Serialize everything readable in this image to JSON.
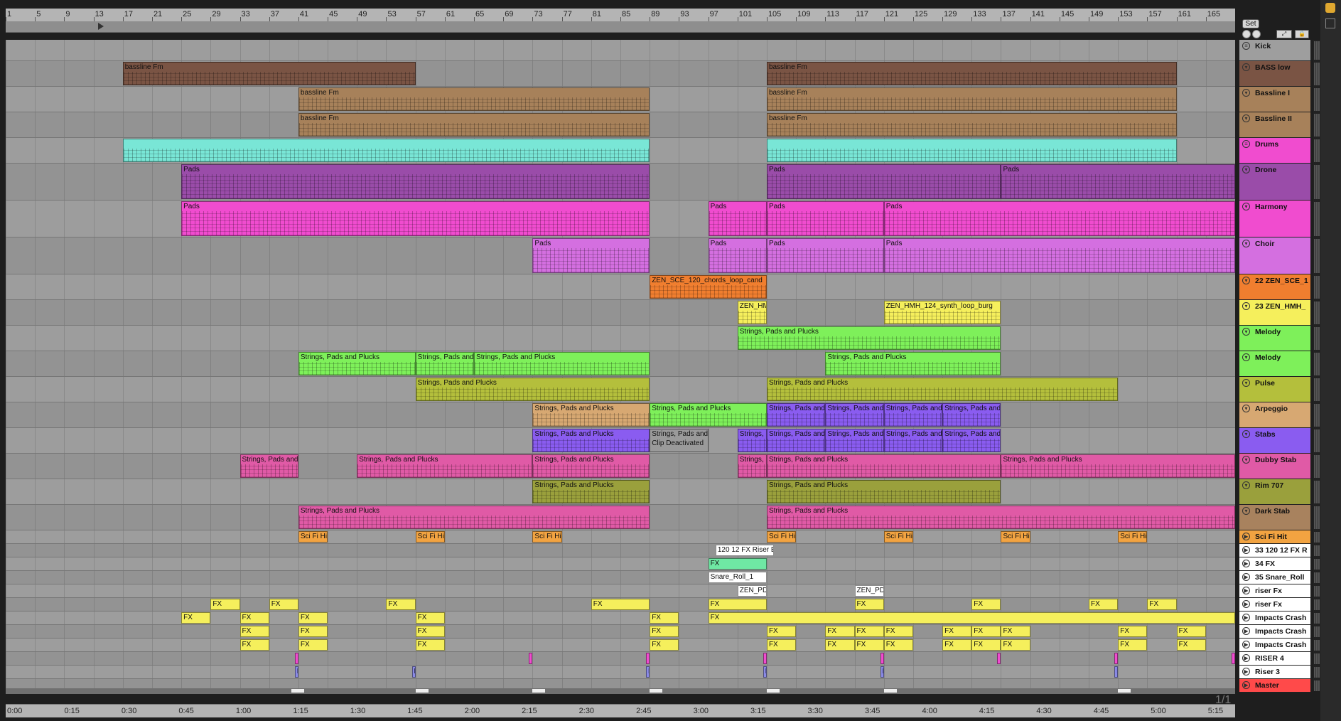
{
  "ruler": {
    "bars": [
      "1",
      "5",
      "9",
      "13",
      "17",
      "21",
      "25",
      "29",
      "33",
      "37",
      "41",
      "45",
      "49",
      "53",
      "57",
      "61",
      "65",
      "69",
      "73",
      "77",
      "81",
      "85",
      "89",
      "93",
      "97",
      "101",
      "105",
      "109",
      "113",
      "117",
      "121",
      "125",
      "129",
      "133",
      "137",
      "141",
      "145",
      "149",
      "153",
      "157",
      "161",
      "165"
    ]
  },
  "timeline": {
    "labels": [
      "0:00",
      "0:15",
      "0:30",
      "0:45",
      "1:00",
      "1:15",
      "1:30",
      "1:45",
      "2:00",
      "2:15",
      "2:30",
      "2:45",
      "3:00",
      "3:15",
      "3:30",
      "3:45",
      "4:00",
      "4:15",
      "4:30",
      "4:45",
      "5:00",
      "5:15"
    ]
  },
  "controls": {
    "set_label": "Set",
    "zoom_label": "1/1"
  },
  "tracks": [
    {
      "name": "Kick",
      "color": "#9e9e9e",
      "icon": "menu"
    },
    {
      "name": "BASS low",
      "color": "#7a5444",
      "icon": "chevron-down"
    },
    {
      "name": "Bassline I",
      "color": "#a7815a",
      "icon": "chevron-down"
    },
    {
      "name": "Bassline II",
      "color": "#a7815a",
      "icon": "chevron-down"
    },
    {
      "name": "Drums",
      "color": "#f04ccf",
      "icon": "menu"
    },
    {
      "name": "Drone",
      "color": "#9a4ca9",
      "icon": "chevron-down"
    },
    {
      "name": "Harmony",
      "color": "#f04ccf",
      "icon": "chevron-down"
    },
    {
      "name": "Choir",
      "color": "#d46fe0",
      "icon": "chevron-down"
    },
    {
      "name": "22 ZEN_SCE_1",
      "color": "#f07e2f",
      "icon": "chevron-down"
    },
    {
      "name": "23 ZEN_HMH_",
      "color": "#f5ef5c",
      "icon": "chevron-down"
    },
    {
      "name": "Melody",
      "color": "#7ef05a",
      "icon": "chevron-down"
    },
    {
      "name": "Melody",
      "color": "#7ef05a",
      "icon": "chevron-down"
    },
    {
      "name": "Pulse",
      "color": "#b4bf3c",
      "icon": "chevron-down"
    },
    {
      "name": "Arpeggio",
      "color": "#d7a872",
      "icon": "chevron-down"
    },
    {
      "name": "Stabs",
      "color": "#8a5cf0",
      "icon": "chevron-down"
    },
    {
      "name": "Dubby Stab",
      "color": "#e05aa6",
      "icon": "chevron-down"
    },
    {
      "name": "Rim 707",
      "color": "#9aa03c",
      "icon": "chevron-down"
    },
    {
      "name": "Dark Stab",
      "color": "#a8825e",
      "icon": "chevron-down"
    },
    {
      "name": "Sci Fi Hit",
      "color": "#f2a341",
      "icon": "play"
    },
    {
      "name": "33 120 12 FX R",
      "color": "#ffffff",
      "icon": "play"
    },
    {
      "name": "34 FX",
      "color": "#ffffff",
      "icon": "play"
    },
    {
      "name": "35 Snare_Roll",
      "color": "#ffffff",
      "icon": "play"
    },
    {
      "name": "riser Fx",
      "color": "#ffffff",
      "icon": "play"
    },
    {
      "name": "riser Fx",
      "color": "#ffffff",
      "icon": "play"
    },
    {
      "name": "Impacts Crash",
      "color": "#ffffff",
      "icon": "play"
    },
    {
      "name": "Impacts Crash",
      "color": "#ffffff",
      "icon": "play"
    },
    {
      "name": "Impacts Crash",
      "color": "#ffffff",
      "icon": "play"
    },
    {
      "name": "RISER 4",
      "color": "#ffffff",
      "icon": "play"
    },
    {
      "name": "Riser 3",
      "color": "#ffffff",
      "icon": "play"
    },
    {
      "name": "Master",
      "color": "#ff4a4a",
      "icon": "play"
    }
  ],
  "clips": [
    {
      "track": 1,
      "start": 17,
      "end": 57,
      "label": "bassline Fm",
      "color": "#7a5444"
    },
    {
      "track": 1,
      "start": 105,
      "end": 161,
      "label": "bassline Fm",
      "color": "#7a5444"
    },
    {
      "track": 2,
      "start": 41,
      "end": 89,
      "label": "bassline Fm",
      "color": "#a7815a"
    },
    {
      "track": 2,
      "start": 105,
      "end": 161,
      "label": "bassline Fm",
      "color": "#a7815a"
    },
    {
      "track": 3,
      "start": 41,
      "end": 89,
      "label": "bassline Fm",
      "color": "#a7815a"
    },
    {
      "track": 3,
      "start": 105,
      "end": 161,
      "label": "bassline Fm",
      "color": "#a7815a"
    },
    {
      "track": 4,
      "start": 17,
      "end": 89,
      "label": "",
      "color": "#79e6d6"
    },
    {
      "track": 4,
      "start": 105,
      "end": 161,
      "label": "",
      "color": "#79e6d6"
    },
    {
      "track": 5,
      "start": 25,
      "end": 89,
      "label": "Pads",
      "color": "#9a4ca9"
    },
    {
      "track": 5,
      "start": 105,
      "end": 137,
      "label": "Pads",
      "color": "#9a4ca9"
    },
    {
      "track": 5,
      "start": 137,
      "end": 169,
      "label": "Pads",
      "color": "#9a4ca9"
    },
    {
      "track": 6,
      "start": 25,
      "end": 89,
      "label": "Pads",
      "color": "#f04ccf"
    },
    {
      "track": 6,
      "start": 97,
      "end": 105,
      "label": "Pads",
      "color": "#f04ccf"
    },
    {
      "track": 6,
      "start": 105,
      "end": 121,
      "label": "Pads",
      "color": "#f04ccf"
    },
    {
      "track": 6,
      "start": 121,
      "end": 169,
      "label": "Pads",
      "color": "#f04ccf"
    },
    {
      "track": 7,
      "start": 73,
      "end": 89,
      "label": "Pads",
      "color": "#d46fe0"
    },
    {
      "track": 7,
      "start": 97,
      "end": 105,
      "label": "Pads",
      "color": "#d46fe0"
    },
    {
      "track": 7,
      "start": 105,
      "end": 121,
      "label": "Pads",
      "color": "#d46fe0"
    },
    {
      "track": 7,
      "start": 121,
      "end": 169,
      "label": "Pads",
      "color": "#d46fe0"
    },
    {
      "track": 8,
      "start": 89,
      "end": 105,
      "label": "ZEN_SCE_120_chords_loop_cand",
      "color": "#f07e2f"
    },
    {
      "track": 9,
      "start": 101,
      "end": 105,
      "label": "ZEN_HM",
      "color": "#f5ef5c"
    },
    {
      "track": 9,
      "start": 121,
      "end": 137,
      "label": "ZEN_HMH_124_synth_loop_burg",
      "color": "#f5ef5c"
    },
    {
      "track": 10,
      "start": 101,
      "end": 137,
      "label": "Strings, Pads and Plucks",
      "color": "#7ef05a"
    },
    {
      "track": 11,
      "start": 41,
      "end": 57,
      "label": "Strings, Pads and Plucks",
      "color": "#7ef05a"
    },
    {
      "track": 11,
      "start": 57,
      "end": 65,
      "label": "Strings, Pads and",
      "color": "#7ef05a"
    },
    {
      "track": 11,
      "start": 65,
      "end": 89,
      "label": "Strings, Pads and Plucks",
      "color": "#7ef05a"
    },
    {
      "track": 11,
      "start": 113,
      "end": 137,
      "label": "Strings, Pads and Plucks",
      "color": "#7ef05a"
    },
    {
      "track": 12,
      "start": 57,
      "end": 89,
      "label": "Strings, Pads and Plucks",
      "color": "#b4bf3c"
    },
    {
      "track": 12,
      "start": 105,
      "end": 153,
      "label": "Strings, Pads and Plucks",
      "color": "#b4bf3c"
    },
    {
      "track": 13,
      "start": 73,
      "end": 89,
      "label": "Strings, Pads and Plucks",
      "color": "#d7a872"
    },
    {
      "track": 13,
      "start": 89,
      "end": 105,
      "label": "Strings, Pads and Plucks",
      "color": "#7ef05a"
    },
    {
      "track": 13,
      "start": 105,
      "end": 113,
      "label": "Strings, Pads and",
      "color": "#8a5cf0"
    },
    {
      "track": 13,
      "start": 113,
      "end": 121,
      "label": "Strings, Pads and",
      "color": "#8a5cf0"
    },
    {
      "track": 13,
      "start": 121,
      "end": 129,
      "label": "Strings, Pads and",
      "color": "#8a5cf0"
    },
    {
      "track": 13,
      "start": 129,
      "end": 137,
      "label": "Strings, Pads and",
      "color": "#8a5cf0"
    },
    {
      "track": 14,
      "start": 73,
      "end": 89,
      "label": "Strings, Pads and Plucks",
      "color": "#8a5cf0"
    },
    {
      "track": 14,
      "start": 89,
      "end": 97,
      "label": "Strings, Pads and",
      "color": "#9a9a9a",
      "deact": "Clip Deactivated"
    },
    {
      "track": 14,
      "start": 101,
      "end": 105,
      "label": "Strings,",
      "color": "#8a5cf0"
    },
    {
      "track": 14,
      "start": 105,
      "end": 113,
      "label": "Strings, Pads and",
      "color": "#8a5cf0"
    },
    {
      "track": 14,
      "start": 113,
      "end": 121,
      "label": "Strings, Pads and",
      "color": "#8a5cf0"
    },
    {
      "track": 14,
      "start": 121,
      "end": 129,
      "label": "Strings, Pads and",
      "color": "#8a5cf0"
    },
    {
      "track": 14,
      "start": 129,
      "end": 137,
      "label": "Strings, Pads and",
      "color": "#8a5cf0"
    },
    {
      "track": 15,
      "start": 33,
      "end": 41,
      "label": "Strings, Pads and",
      "color": "#e05aa6"
    },
    {
      "track": 15,
      "start": 49,
      "end": 73,
      "label": "Strings, Pads and Plucks",
      "color": "#e05aa6"
    },
    {
      "track": 15,
      "start": 73,
      "end": 89,
      "label": "Strings, Pads and Plucks",
      "color": "#e05aa6"
    },
    {
      "track": 15,
      "start": 101,
      "end": 105,
      "label": "Strings,",
      "color": "#e05aa6"
    },
    {
      "track": 15,
      "start": 105,
      "end": 137,
      "label": "Strings, Pads and Plucks",
      "color": "#e05aa6"
    },
    {
      "track": 15,
      "start": 137,
      "end": 169,
      "label": "Strings, Pads and Plucks",
      "color": "#e05aa6"
    },
    {
      "track": 16,
      "start": 73,
      "end": 89,
      "label": "Strings, Pads and Plucks",
      "color": "#9aa03c"
    },
    {
      "track": 16,
      "start": 105,
      "end": 137,
      "label": "Strings, Pads and Plucks",
      "color": "#9aa03c"
    },
    {
      "track": 17,
      "start": 41,
      "end": 89,
      "label": "Strings, Pads and Plucks",
      "color": "#e05aa6"
    },
    {
      "track": 17,
      "start": 105,
      "end": 169,
      "label": "Strings, Pads and Plucks",
      "color": "#e05aa6"
    },
    {
      "track": 18,
      "start": 41,
      "end": 45,
      "label": "Sci Fi Hi",
      "color": "#f2a341"
    },
    {
      "track": 18,
      "start": 57,
      "end": 61,
      "label": "Sci Fi Hi",
      "color": "#f2a341"
    },
    {
      "track": 18,
      "start": 73,
      "end": 77,
      "label": "Sci Fi Hi",
      "color": "#f2a341"
    },
    {
      "track": 18,
      "start": 105,
      "end": 109,
      "label": "Sci Fi Hi",
      "color": "#f2a341"
    },
    {
      "track": 18,
      "start": 121,
      "end": 125,
      "label": "Sci Fi Hi",
      "color": "#f2a341"
    },
    {
      "track": 18,
      "start": 137,
      "end": 141,
      "label": "Sci Fi Hi",
      "color": "#f2a341"
    },
    {
      "track": 18,
      "start": 153,
      "end": 157,
      "label": "Sci Fi Hi",
      "color": "#f2a341"
    },
    {
      "track": 19,
      "start": 98,
      "end": 106,
      "label": "120 12 FX Riser E",
      "color": "#ffffff"
    },
    {
      "track": 20,
      "start": 97,
      "end": 105,
      "label": "FX",
      "color": "#6fe8a4"
    },
    {
      "track": 21,
      "start": 97,
      "end": 105,
      "label": "Snare_Roll_1",
      "color": "#ffffff"
    },
    {
      "track": 22,
      "start": 101,
      "end": 105,
      "label": "ZEN_PD",
      "color": "#ffffff"
    },
    {
      "track": 22,
      "start": 117,
      "end": 121,
      "label": "ZEN_PD",
      "color": "#ffffff"
    },
    {
      "track": 23,
      "start": 29,
      "end": 33,
      "label": "FX",
      "color": "#f5ef5c"
    },
    {
      "track": 23,
      "start": 37,
      "end": 41,
      "label": "FX",
      "color": "#f5ef5c"
    },
    {
      "track": 23,
      "start": 53,
      "end": 57,
      "label": "FX",
      "color": "#f5ef5c"
    },
    {
      "track": 23,
      "start": 81,
      "end": 89,
      "label": "FX",
      "color": "#f5ef5c"
    },
    {
      "track": 23,
      "start": 97,
      "end": 105,
      "label": "FX",
      "color": "#f5ef5c"
    },
    {
      "track": 23,
      "start": 117,
      "end": 121,
      "label": "FX",
      "color": "#f5ef5c"
    },
    {
      "track": 23,
      "start": 133,
      "end": 137,
      "label": "FX",
      "color": "#f5ef5c"
    },
    {
      "track": 23,
      "start": 149,
      "end": 153,
      "label": "FX",
      "color": "#f5ef5c"
    },
    {
      "track": 23,
      "start": 157,
      "end": 161,
      "label": "FX",
      "color": "#f5ef5c"
    },
    {
      "track": 24,
      "start": 25,
      "end": 29,
      "label": "FX",
      "color": "#f5ef5c"
    },
    {
      "track": 24,
      "start": 33,
      "end": 37,
      "label": "FX",
      "color": "#f5ef5c"
    },
    {
      "track": 24,
      "start": 41,
      "end": 45,
      "label": "FX",
      "color": "#f5ef5c"
    },
    {
      "track": 24,
      "start": 57,
      "end": 61,
      "label": "FX",
      "color": "#f5ef5c"
    },
    {
      "track": 24,
      "start": 89,
      "end": 93,
      "label": "FX",
      "color": "#f5ef5c"
    },
    {
      "track": 24,
      "start": 97,
      "end": 169,
      "label": "FX",
      "color": "#f5ef5c"
    },
    {
      "track": 25,
      "start": 33,
      "end": 37,
      "label": "FX",
      "color": "#f5ef5c"
    },
    {
      "track": 25,
      "start": 41,
      "end": 45,
      "label": "FX",
      "color": "#f5ef5c"
    },
    {
      "track": 25,
      "start": 57,
      "end": 61,
      "label": "FX",
      "color": "#f5ef5c"
    },
    {
      "track": 25,
      "start": 89,
      "end": 93,
      "label": "FX",
      "color": "#f5ef5c"
    },
    {
      "track": 25,
      "start": 105,
      "end": 109,
      "label": "FX",
      "color": "#f5ef5c"
    },
    {
      "track": 25,
      "start": 113,
      "end": 117,
      "label": "FX",
      "color": "#f5ef5c"
    },
    {
      "track": 25,
      "start": 117,
      "end": 121,
      "label": "FX",
      "color": "#f5ef5c"
    },
    {
      "track": 25,
      "start": 121,
      "end": 125,
      "label": "FX",
      "color": "#f5ef5c"
    },
    {
      "track": 25,
      "start": 129,
      "end": 133,
      "label": "FX",
      "color": "#f5ef5c"
    },
    {
      "track": 25,
      "start": 133,
      "end": 137,
      "label": "FX",
      "color": "#f5ef5c"
    },
    {
      "track": 25,
      "start": 137,
      "end": 141,
      "label": "FX",
      "color": "#f5ef5c"
    },
    {
      "track": 25,
      "start": 153,
      "end": 157,
      "label": "FX",
      "color": "#f5ef5c"
    },
    {
      "track": 25,
      "start": 161,
      "end": 165,
      "label": "FX",
      "color": "#f5ef5c"
    },
    {
      "track": 26,
      "start": 33,
      "end": 37,
      "label": "FX",
      "color": "#f5ef5c"
    },
    {
      "track": 26,
      "start": 41,
      "end": 45,
      "label": "FX",
      "color": "#f5ef5c"
    },
    {
      "track": 26,
      "start": 57,
      "end": 61,
      "label": "FX",
      "color": "#f5ef5c"
    },
    {
      "track": 26,
      "start": 89,
      "end": 93,
      "label": "FX",
      "color": "#f5ef5c"
    },
    {
      "track": 26,
      "start": 105,
      "end": 109,
      "label": "FX",
      "color": "#f5ef5c"
    },
    {
      "track": 26,
      "start": 113,
      "end": 117,
      "label": "FX",
      "color": "#f5ef5c"
    },
    {
      "track": 26,
      "start": 117,
      "end": 121,
      "label": "FX",
      "color": "#f5ef5c"
    },
    {
      "track": 26,
      "start": 121,
      "end": 125,
      "label": "FX",
      "color": "#f5ef5c"
    },
    {
      "track": 26,
      "start": 129,
      "end": 133,
      "label": "FX",
      "color": "#f5ef5c"
    },
    {
      "track": 26,
      "start": 133,
      "end": 137,
      "label": "FX",
      "color": "#f5ef5c"
    },
    {
      "track": 26,
      "start": 137,
      "end": 141,
      "label": "FX",
      "color": "#f5ef5c"
    },
    {
      "track": 26,
      "start": 153,
      "end": 157,
      "label": "FX",
      "color": "#f5ef5c"
    },
    {
      "track": 26,
      "start": 161,
      "end": 165,
      "label": "FX",
      "color": "#f5ef5c"
    },
    {
      "track": 27,
      "start": 40.5,
      "end": 41,
      "label": "",
      "color": "#f04ccf"
    },
    {
      "track": 27,
      "start": 72.5,
      "end": 73,
      "label": "",
      "color": "#f04ccf"
    },
    {
      "track": 27,
      "start": 88.5,
      "end": 89,
      "label": "",
      "color": "#f04ccf"
    },
    {
      "track": 27,
      "start": 104.5,
      "end": 105,
      "label": "",
      "color": "#f04ccf"
    },
    {
      "track": 27,
      "start": 120.5,
      "end": 121,
      "label": "",
      "color": "#f04ccf"
    },
    {
      "track": 27,
      "start": 136.5,
      "end": 137,
      "label": "",
      "color": "#f04ccf"
    },
    {
      "track": 27,
      "start": 152.5,
      "end": 153,
      "label": "",
      "color": "#f04ccf"
    },
    {
      "track": 27,
      "start": 168.5,
      "end": 169,
      "label": "",
      "color": "#f04ccf"
    },
    {
      "track": 28,
      "start": 40.5,
      "end": 41,
      "label": "F",
      "color": "#8a8ae6"
    },
    {
      "track": 28,
      "start": 56.5,
      "end": 57,
      "label": "F",
      "color": "#8a8ae6"
    },
    {
      "track": 28,
      "start": 88.5,
      "end": 89,
      "label": "F",
      "color": "#8a8ae6"
    },
    {
      "track": 28,
      "start": 104.5,
      "end": 105,
      "label": "F",
      "color": "#8a8ae6"
    },
    {
      "track": 28,
      "start": 120.5,
      "end": 121,
      "label": "F",
      "color": "#8a8ae6"
    },
    {
      "track": 28,
      "start": 152.5,
      "end": 153,
      "label": "F",
      "color": "#8a8ae6"
    }
  ]
}
